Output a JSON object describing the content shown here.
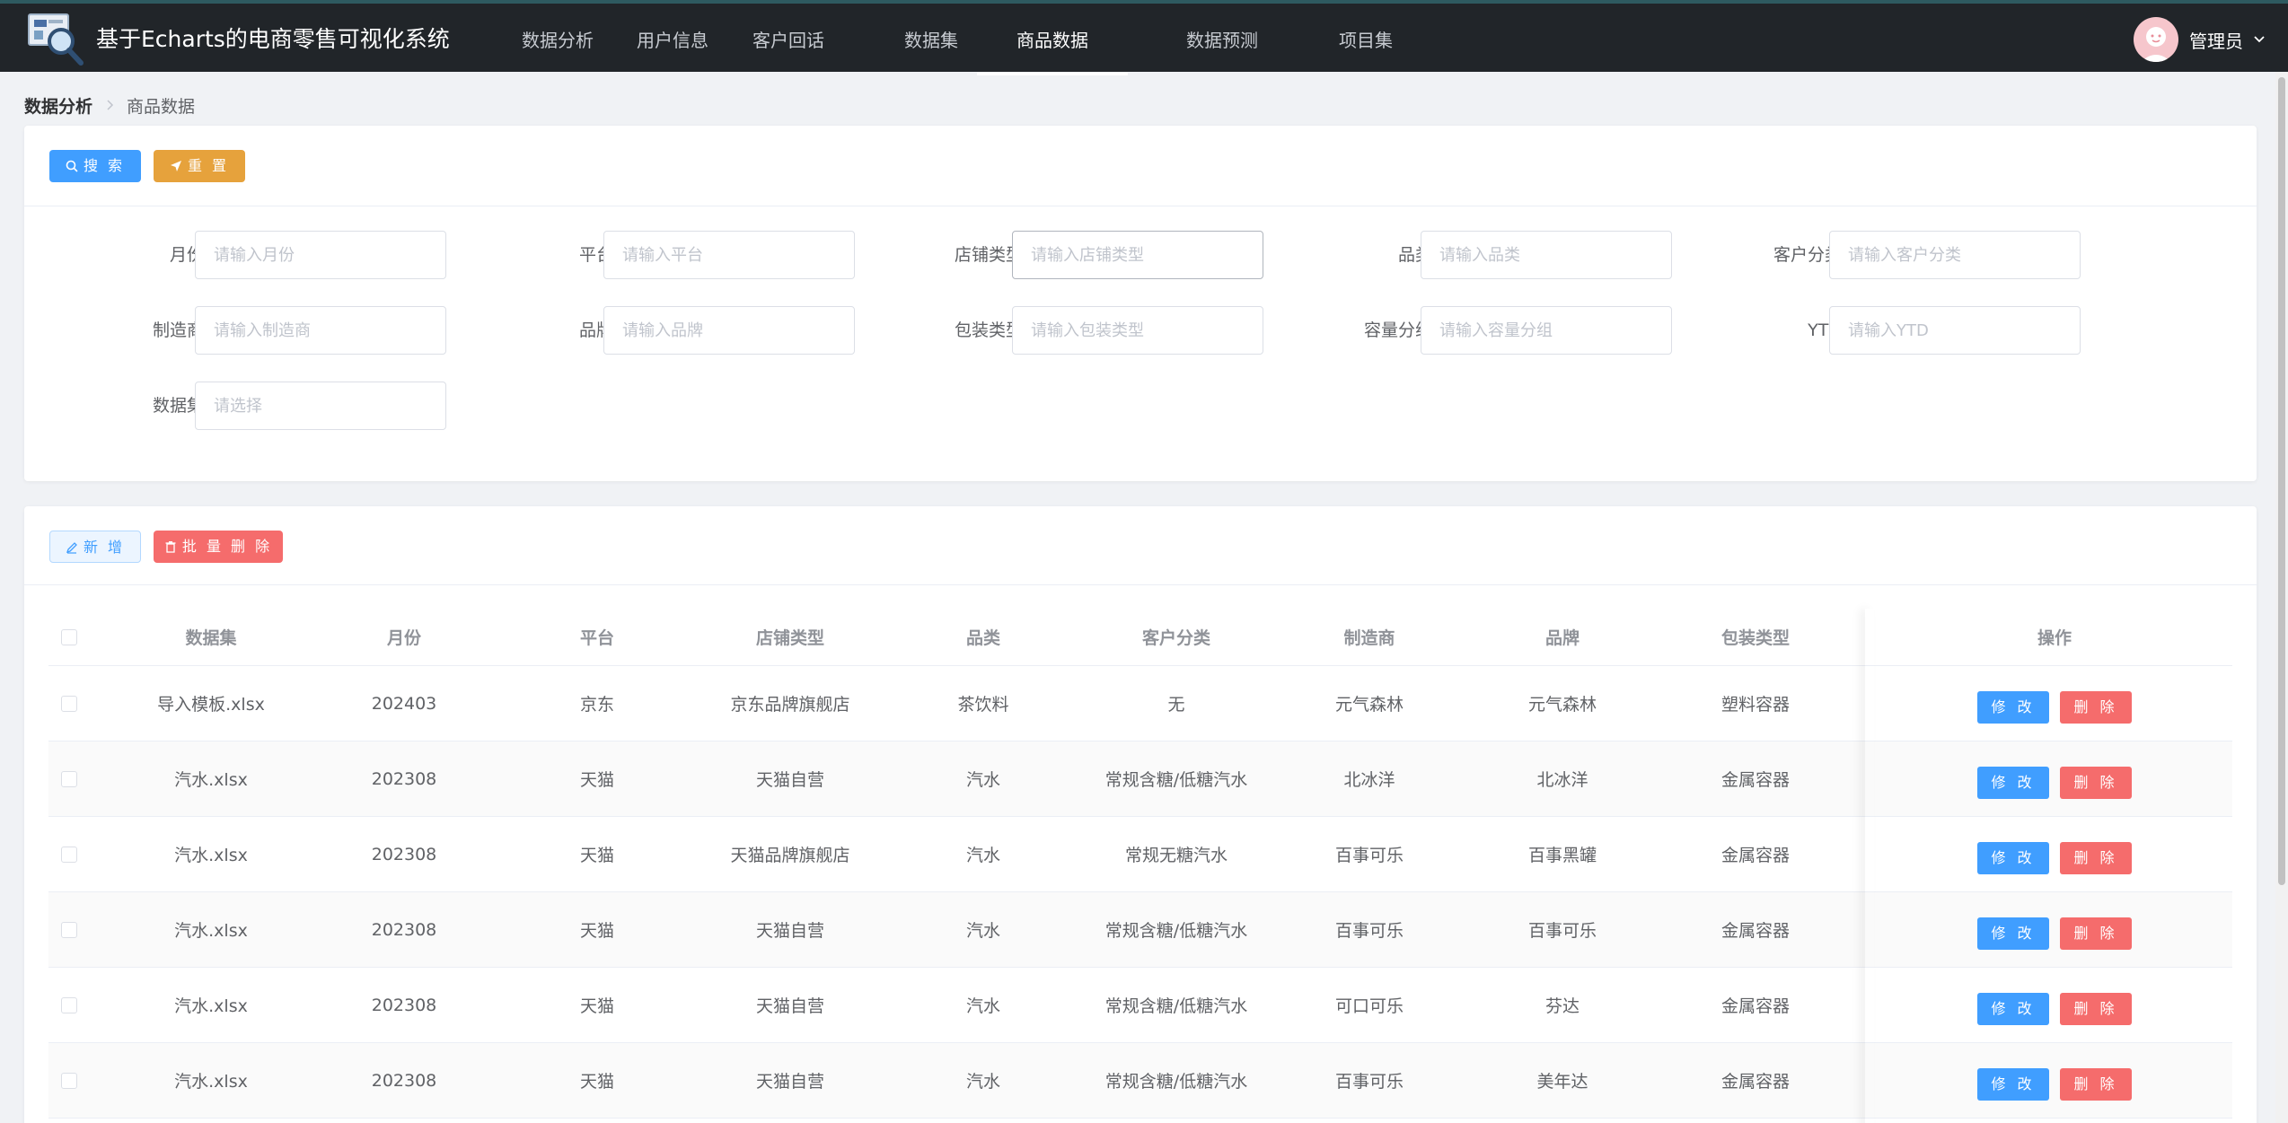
{
  "header": {
    "title": "基于Echarts的电商零售可视化系统",
    "nav": [
      {
        "label": "数据分析",
        "active": false
      },
      {
        "label": "用户信息",
        "active": false
      },
      {
        "label": "客户回话",
        "active": false
      },
      {
        "label": "数据集",
        "active": false
      },
      {
        "label": "商品数据",
        "active": true
      },
      {
        "label": "数据预测",
        "active": false
      },
      {
        "label": "项目集",
        "active": false
      }
    ],
    "user": "管理员"
  },
  "breadcrumb": {
    "root": "数据分析",
    "current": "商品数据"
  },
  "search": {
    "search_button": "搜 索",
    "reset_button": "重 置",
    "fields": [
      {
        "label": "月份",
        "placeholder": "请输入月份"
      },
      {
        "label": "平台",
        "placeholder": "请输入平台"
      },
      {
        "label": "店铺类型",
        "placeholder": "请输入店铺类型"
      },
      {
        "label": "品类",
        "placeholder": "请输入品类"
      },
      {
        "label": "客户分类",
        "placeholder": "请输入客户分类"
      },
      {
        "label": "制造商",
        "placeholder": "请输入制造商"
      },
      {
        "label": "品牌",
        "placeholder": "请输入品牌"
      },
      {
        "label": "包装类型",
        "placeholder": "请输入包装类型"
      },
      {
        "label": "容量分组",
        "placeholder": "请输入容量分组"
      },
      {
        "label": "YTD",
        "placeholder": "请输入YTD"
      },
      {
        "label": "数据集",
        "placeholder": "请选择"
      }
    ]
  },
  "toolbar": {
    "add_button": "新 增",
    "batch_delete_button": "批 量 删 除"
  },
  "table": {
    "columns": [
      "数据集",
      "月份",
      "平台",
      "店铺类型",
      "品类",
      "客户分类",
      "制造商",
      "品牌",
      "包装类型",
      "操作"
    ],
    "edit_label": "修 改",
    "delete_label": "删 除",
    "rows": [
      [
        "导入模板.xlsx",
        "202403",
        "京东",
        "京东品牌旗舰店",
        "茶饮料",
        "无",
        "元气森林",
        "元气森林",
        "塑料容器"
      ],
      [
        "汽水.xlsx",
        "202308",
        "天猫",
        "天猫自营",
        "汽水",
        "常规含糖/低糖汽水",
        "北冰洋",
        "北冰洋",
        "金属容器"
      ],
      [
        "汽水.xlsx",
        "202308",
        "天猫",
        "天猫品牌旗舰店",
        "汽水",
        "常规无糖汽水",
        "百事可乐",
        "百事黑罐",
        "金属容器"
      ],
      [
        "汽水.xlsx",
        "202308",
        "天猫",
        "天猫自营",
        "汽水",
        "常规含糖/低糖汽水",
        "百事可乐",
        "百事可乐",
        "金属容器"
      ],
      [
        "汽水.xlsx",
        "202308",
        "天猫",
        "天猫自营",
        "汽水",
        "常规含糖/低糖汽水",
        "可口可乐",
        "芬达",
        "金属容器"
      ],
      [
        "汽水.xlsx",
        "202308",
        "天猫",
        "天猫自营",
        "汽水",
        "常规含糖/低糖汽水",
        "百事可乐",
        "美年达",
        "金属容器"
      ]
    ]
  }
}
